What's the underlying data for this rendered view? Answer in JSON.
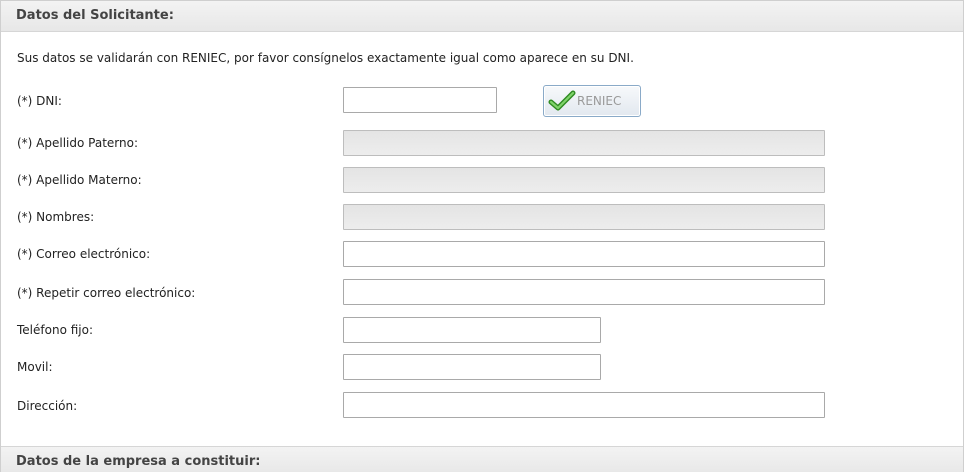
{
  "section1": {
    "title": "Datos del Solicitante:",
    "intro": "Sus datos se validarán con RENIEC, por favor consígnelos exactamente igual como aparece en su DNI."
  },
  "fields": {
    "dni": {
      "label": "(*) DNI:",
      "value": ""
    },
    "reniec_button": "RENIEC",
    "apellido_paterno": {
      "label": "(*) Apellido Paterno:",
      "value": ""
    },
    "apellido_materno": {
      "label": "(*) Apellido Materno:",
      "value": ""
    },
    "nombres": {
      "label": "(*) Nombres:",
      "value": ""
    },
    "correo": {
      "label": "(*) Correo electrónico:",
      "value": ""
    },
    "repetir_correo": {
      "label": "(*) Repetir correo electrónico:",
      "value": ""
    },
    "telefono": {
      "label": "Teléfono fijo:",
      "value": ""
    },
    "movil": {
      "label": "Movil:",
      "value": ""
    },
    "direccion": {
      "label": "Dirección:",
      "value": ""
    }
  },
  "section2": {
    "title": "Datos de la empresa a constituir:"
  },
  "icons": {
    "reniec_button_icon": "green-checkmark-icon"
  },
  "colors": {
    "header_bg": "#ececec",
    "disabled_field_bg": "#e8e8e8",
    "button_border": "#8aaac8",
    "check_green": "#3a9a2a"
  }
}
